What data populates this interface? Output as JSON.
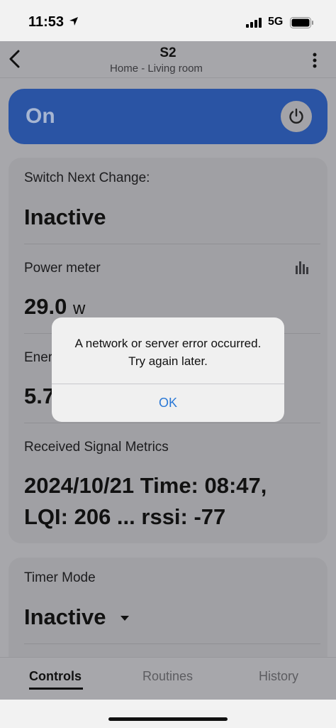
{
  "status_bar": {
    "time": "11:53",
    "network": "5G"
  },
  "header": {
    "title": "S2",
    "subtitle": "Home - Living room"
  },
  "switch": {
    "state_label": "On"
  },
  "metrics": {
    "switch_next_change_label": "Switch Next Change:",
    "switch_next_change_value": "Inactive",
    "power_meter_label": "Power meter",
    "power_meter_value": "29.0",
    "power_meter_unit": "w",
    "energy_label": "Energ",
    "energy_value": "5.7",
    "signal_label": "Received Signal Metrics",
    "signal_line1": "2024/10/21 Time: 08:47,",
    "signal_line2": "LQI: 206 ... rssi: -77"
  },
  "timer": {
    "label": "Timer Mode",
    "value": "Inactive"
  },
  "tabs": [
    {
      "label": "Controls",
      "active": true
    },
    {
      "label": "Routines",
      "active": false
    },
    {
      "label": "History",
      "active": false
    }
  ],
  "alert": {
    "message_line1": "A network or server error occurred.",
    "message_line2": "Try again later.",
    "ok_label": "OK"
  },
  "colors": {
    "accent_blue": "#2a54a4",
    "link_blue": "#2a78d6"
  }
}
